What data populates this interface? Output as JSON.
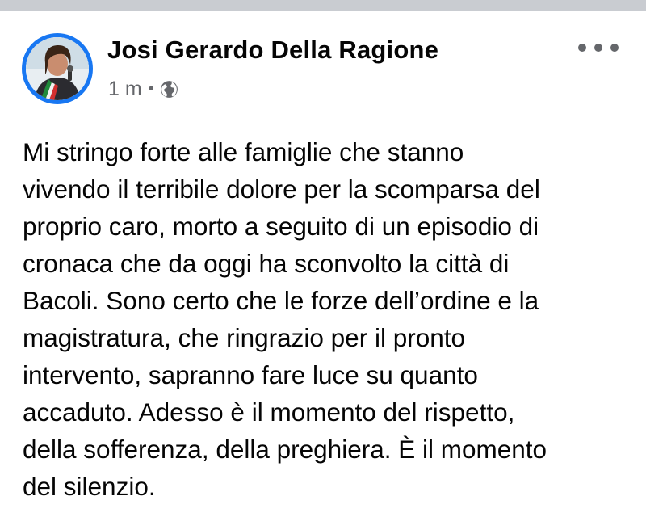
{
  "post": {
    "author": "Josi Gerardo Della Ragione",
    "timestamp": "1 m",
    "separator": "•",
    "privacy_icon": "globe-icon",
    "more_icon": "more-horizontal-icon",
    "text_lines": [
      "Mi stringo forte alle famiglie che stanno",
      "vivendo il terribile dolore per la scomparsa del",
      "proprio caro, morto a seguito di un episodio di",
      "cronaca che da oggi ha sconvolto la città di",
      "Bacoli. Sono certo che le forze dell’ordine e la",
      "magistratura, che ringrazio per il pronto",
      "intervento, sapranno fare luce su quanto",
      "accaduto. Adesso è il momento del rispetto,",
      "della sofferenza, della preghiera. È il momento",
      "del silenzio."
    ]
  },
  "colors": {
    "accent": "#1877f2",
    "meta_text": "#65676b",
    "body_text": "#050505",
    "top_strip": "#c9ccd1"
  }
}
